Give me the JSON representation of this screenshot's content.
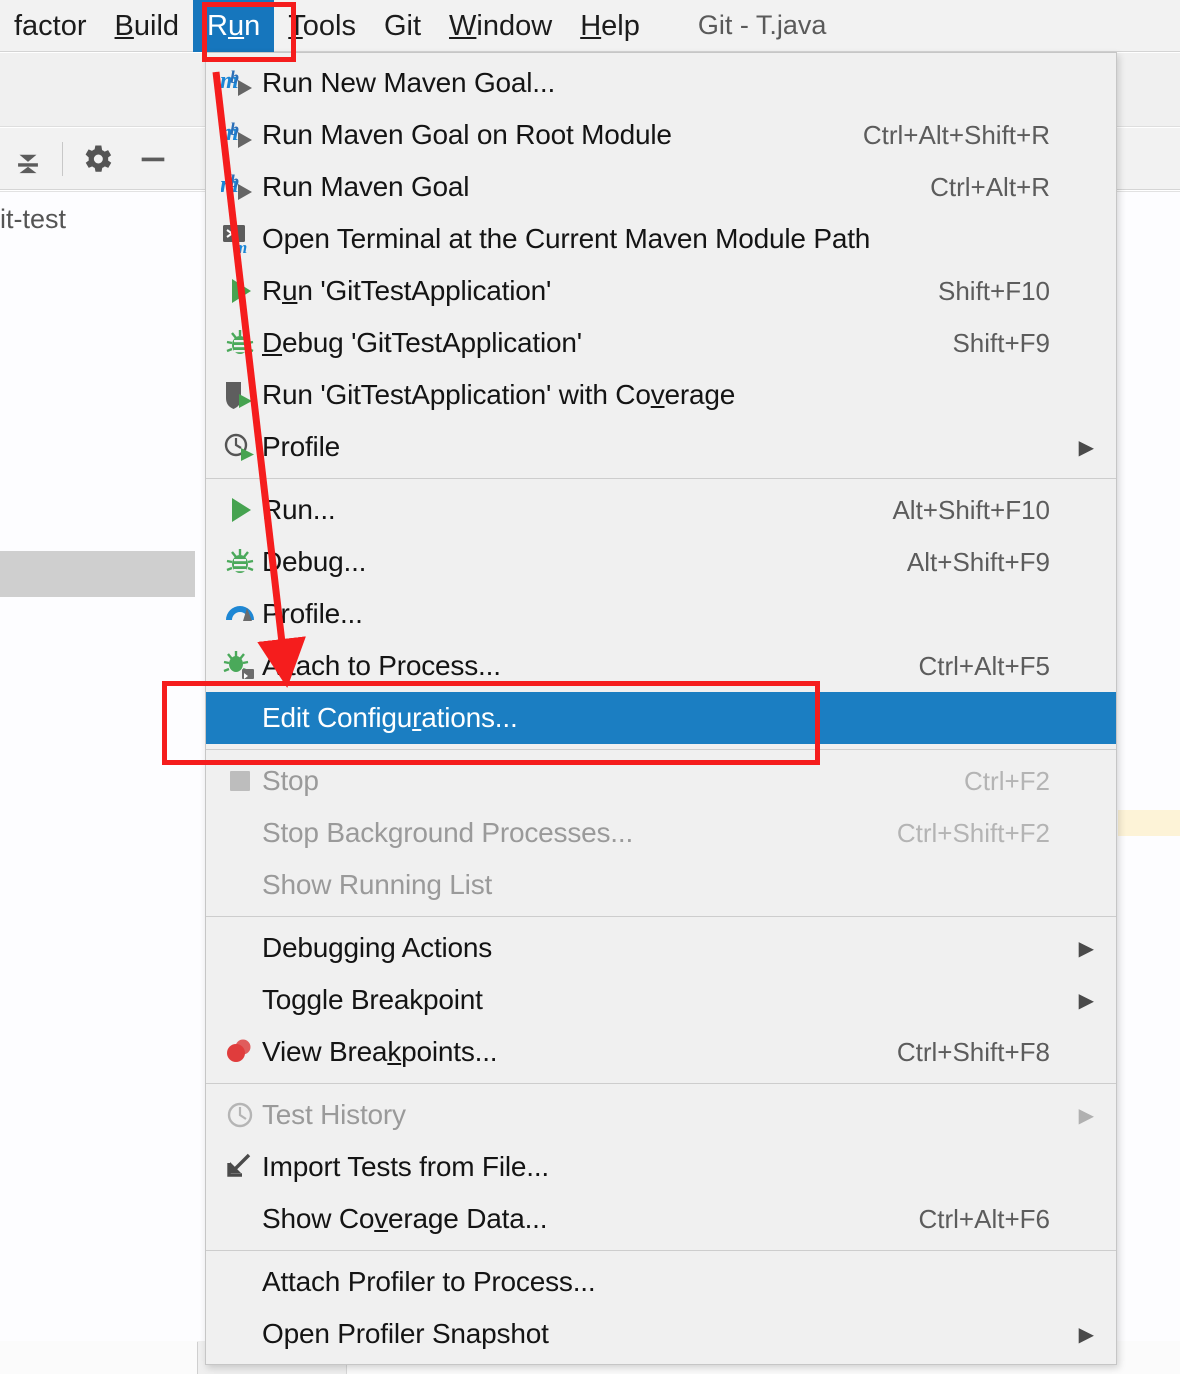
{
  "window": {
    "title": "Git - T.java"
  },
  "menubar": {
    "items": [
      {
        "label": "factor",
        "mnemonic": "",
        "active": false
      },
      {
        "label": "Build",
        "mnemonic": "B",
        "active": false
      },
      {
        "label": "Run",
        "mnemonic": "u",
        "active": true
      },
      {
        "label": "Tools",
        "mnemonic": "T",
        "active": false
      },
      {
        "label": "Git",
        "mnemonic": "",
        "active": false
      },
      {
        "label": "Window",
        "mnemonic": "W",
        "active": false
      },
      {
        "label": "Help",
        "mnemonic": "H",
        "active": false
      }
    ]
  },
  "background": {
    "tree_label": "it-test",
    "toolbar_icons": [
      "collapse-all-icon",
      "settings-gear-icon",
      "hide-icon"
    ]
  },
  "run_menu": {
    "groups": [
      {
        "items": [
          {
            "label": "Run New Maven Goal...",
            "accel": "",
            "icon": "maven-run-icon",
            "arrow": false,
            "disabled": false,
            "selected": false
          },
          {
            "label": "Run Maven Goal on Root Module",
            "accel": "Ctrl+Alt+Shift+R",
            "icon": "maven-run-icon",
            "arrow": false,
            "disabled": false,
            "selected": false
          },
          {
            "label": "Run Maven Goal",
            "accel": "Ctrl+Alt+R",
            "icon": "maven-run-icon",
            "arrow": false,
            "disabled": false,
            "selected": false
          },
          {
            "label": "Open Terminal at the Current Maven Module Path",
            "accel": "",
            "icon": "terminal-maven-icon",
            "arrow": false,
            "disabled": false,
            "selected": false
          },
          {
            "label": "Run 'GitTestApplication'",
            "mnemonic": "u",
            "accel": "Shift+F10",
            "icon": "run-green-play-icon",
            "arrow": false,
            "disabled": false,
            "selected": false
          },
          {
            "label": "Debug 'GitTestApplication'",
            "mnemonic": "D",
            "accel": "Shift+F9",
            "icon": "debug-bug-icon",
            "arrow": false,
            "disabled": false,
            "selected": false
          },
          {
            "label": "Run 'GitTestApplication' with Coverage",
            "mnemonic": "v",
            "accel": "",
            "icon": "coverage-shield-icon",
            "arrow": false,
            "disabled": false,
            "selected": false
          },
          {
            "label": "Profile",
            "accel": "",
            "icon": "profile-clock-run-icon",
            "arrow": true,
            "disabled": false,
            "selected": false
          }
        ]
      },
      {
        "items": [
          {
            "label": "Run...",
            "accel": "Alt+Shift+F10",
            "icon": "run-green-play-icon",
            "arrow": false,
            "disabled": false,
            "selected": false
          },
          {
            "label": "Debug...",
            "accel": "Alt+Shift+F9",
            "icon": "debug-bug-icon",
            "arrow": false,
            "disabled": false,
            "selected": false
          },
          {
            "label": "Profile...",
            "accel": "",
            "icon": "profile-gauge-icon",
            "arrow": false,
            "disabled": false,
            "selected": false
          },
          {
            "label": "Attach to Process...",
            "accel": "Ctrl+Alt+F5",
            "icon": "attach-process-icon",
            "arrow": false,
            "disabled": false,
            "selected": false
          },
          {
            "label": "Edit Configurations...",
            "mnemonic": "r",
            "accel": "",
            "icon": "none",
            "arrow": false,
            "disabled": false,
            "selected": true
          }
        ]
      },
      {
        "items": [
          {
            "label": "Stop",
            "accel": "Ctrl+F2",
            "icon": "stop-square-icon",
            "arrow": false,
            "disabled": true,
            "selected": false
          },
          {
            "label": "Stop Background Processes...",
            "accel": "Ctrl+Shift+F2",
            "icon": "none",
            "arrow": false,
            "disabled": true,
            "selected": false
          },
          {
            "label": "Show Running List",
            "accel": "",
            "icon": "none",
            "arrow": false,
            "disabled": true,
            "selected": false
          }
        ]
      },
      {
        "items": [
          {
            "label": "Debugging Actions",
            "accel": "",
            "icon": "none",
            "arrow": true,
            "disabled": false,
            "selected": false
          },
          {
            "label": "Toggle Breakpoint",
            "accel": "",
            "icon": "none",
            "arrow": true,
            "disabled": false,
            "selected": false
          },
          {
            "label": "View Breakpoints...",
            "mnemonic": "k",
            "accel": "Ctrl+Shift+F8",
            "icon": "breakpoint-red-dot-icon",
            "arrow": false,
            "disabled": false,
            "selected": false
          }
        ]
      },
      {
        "items": [
          {
            "label": "Test History",
            "accel": "",
            "icon": "history-clock-icon",
            "arrow": true,
            "disabled": true,
            "selected": false
          },
          {
            "label": "Import Tests from File...",
            "accel": "",
            "icon": "import-arrow-icon",
            "arrow": false,
            "disabled": false,
            "selected": false
          },
          {
            "label": "Show Coverage Data...",
            "mnemonic": "v",
            "accel": "Ctrl+Alt+F6",
            "icon": "none",
            "arrow": false,
            "disabled": false,
            "selected": false
          }
        ]
      },
      {
        "items": [
          {
            "label": "Attach Profiler to Process...",
            "accel": "",
            "icon": "none",
            "arrow": false,
            "disabled": false,
            "selected": false
          },
          {
            "label": "Open Profiler Snapshot",
            "accel": "",
            "icon": "none",
            "arrow": true,
            "disabled": false,
            "selected": false
          }
        ]
      }
    ]
  },
  "annotations": {
    "highlight_color": "#f51d1d",
    "boxes": [
      "run-menubar-highlight",
      "edit-configurations-highlight"
    ],
    "arrow": "red-arrow-pointing-to-edit-configurations"
  },
  "colors": {
    "selection_blue": "#1b7ec2",
    "menu_bg": "#f0f0f0",
    "accent_red": "#f51d1d"
  }
}
